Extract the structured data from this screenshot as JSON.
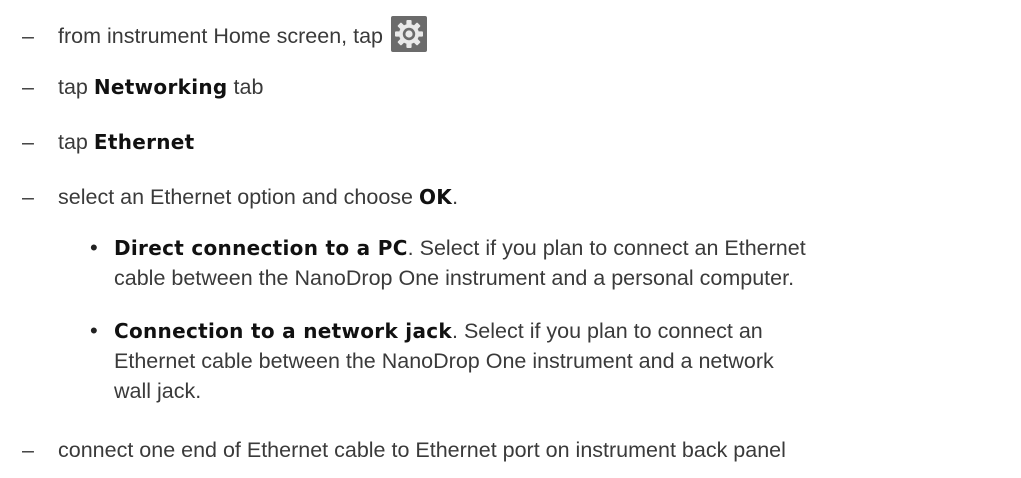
{
  "steps": {
    "s1": {
      "dash": "–",
      "text": "from instrument Home screen, tap",
      "icon": "gear-settings-icon"
    },
    "s2": {
      "dash": "–",
      "pre": "tap",
      "bold": "Networking",
      "post": "tab"
    },
    "s3": {
      "dash": "–",
      "pre": "tap",
      "bold": "Ethernet"
    },
    "s4": {
      "dash": "–",
      "pre": "select an Ethernet option and choose",
      "bold": "OK",
      "post": "."
    },
    "s5": {
      "dash": "–",
      "text": "connect one end of Ethernet cable to Ethernet port on instrument back panel"
    }
  },
  "options": {
    "o1": {
      "bullet": "•",
      "bold": "Direct connection to a PC",
      "line1": ". Select if you plan to connect an Ethernet",
      "line2": "cable between the NanoDrop One instrument and a personal computer."
    },
    "o2": {
      "bullet": "•",
      "bold": "Connection to a network jack",
      "line1": ". Select if you plan to connect an",
      "line2": "Ethernet cable between the NanoDrop One instrument and a network",
      "line3": "wall jack."
    }
  }
}
